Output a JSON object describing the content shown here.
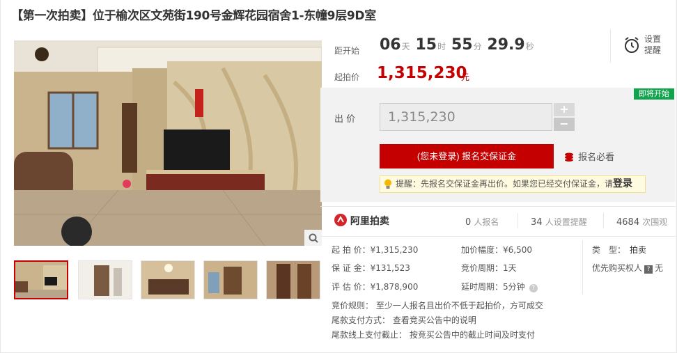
{
  "title": "【第一次拍卖】位于榆次区文苑街190号金辉花园宿舍1-东幢9层9D室",
  "countdown": {
    "label": "距开始",
    "days": "06",
    "days_unit": "天",
    "hours": "15",
    "hours_unit": "时",
    "minutes": "55",
    "minutes_unit": "分",
    "seconds": "29.9",
    "seconds_unit": "秒"
  },
  "start_price": {
    "label": "起拍价",
    "value": "1,315,230",
    "unit": "元"
  },
  "remind": {
    "label_line1": "设置",
    "label_line2": "提醒"
  },
  "status_tag": "即将开始",
  "bid": {
    "label": "出  价",
    "value": "1,315,230",
    "plus": "+",
    "minus": "−",
    "register_button": "(您未登录) 报名交保证金",
    "must_read": "报名必看"
  },
  "tip": {
    "prefix": "提醒：先报名交保证金再出价。如果您已经交付保证金，请",
    "login": "登录"
  },
  "platform": {
    "name": "阿里拍卖"
  },
  "stats": [
    {
      "num": "0",
      "label": "人报名"
    },
    {
      "num": "34",
      "label": "人设置提醒"
    },
    {
      "num": "4684",
      "label": "次围观"
    }
  ],
  "details": {
    "start_price": "起 拍 价：¥1,315,230",
    "deposit": "保 证 金：¥131,523",
    "appraisal": "评 估 价：¥1,878,900",
    "increment": "加价幅度：¥6,500",
    "cycle": "竞价周期：1天",
    "delay": "延时周期：5分钟",
    "type_label": "类　型：",
    "type_value": "拍卖",
    "priority_label": "优先购买权人",
    "priority_badge": "?",
    "priority_value": "无"
  },
  "rules": {
    "bidding_rule": "竞价规则：  至少一人报名且出价不低于起拍价，方可成交",
    "payment_method": "尾款支付方式：  查看竞买公告中的说明",
    "payment_deadline": "尾款线上支付截止：  按竞买公告中的截止时间及时支付"
  },
  "colors": {
    "accent": "#c40000",
    "tag_green": "#13a34f"
  }
}
